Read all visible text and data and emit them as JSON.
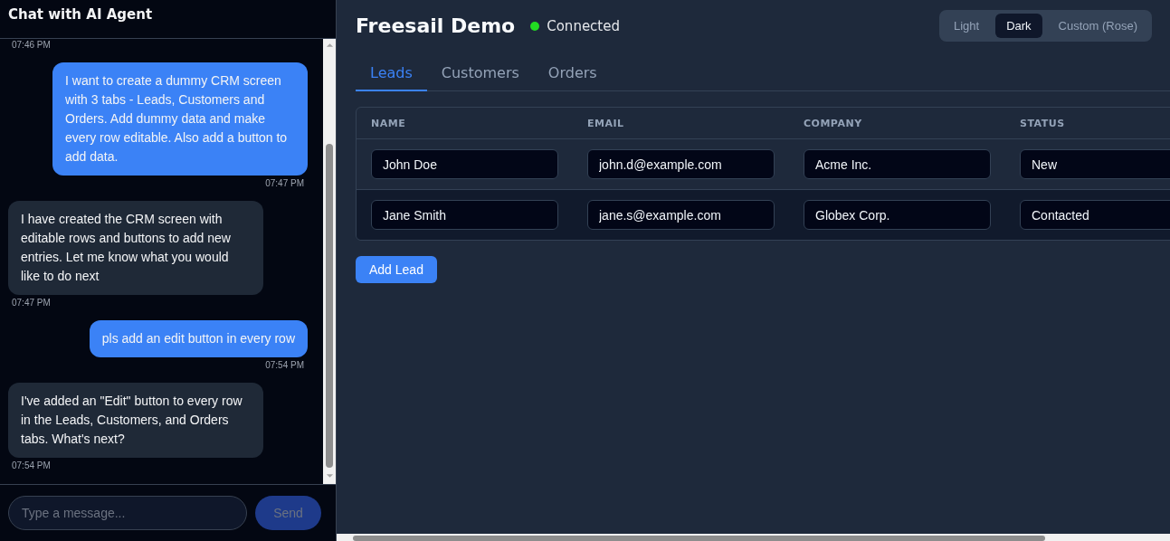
{
  "chat": {
    "title": "Chat with AI Agent",
    "earlier_time": "07:46 PM",
    "messages": [
      {
        "kind": "user",
        "text": "I want to create a dummy CRM screen with 3 tabs - Leads, Customers and Orders. Add dummy data and make every row editable. Also add a button to add data.",
        "time": "07:47 PM"
      },
      {
        "kind": "agent",
        "text": "I have created the CRM screen with editable rows and buttons to add new entries. Let me know what you would like to do next",
        "time": "07:47 PM"
      },
      {
        "kind": "user",
        "text": "pls add an edit button in every row",
        "time": "07:54 PM"
      },
      {
        "kind": "agent",
        "text": "I've added an \"Edit\" button to every row in the Leads, Customers, and Orders tabs. What's next?",
        "time": "07:54 PM"
      }
    ],
    "input": {
      "placeholder": "Type a message..."
    },
    "send_button": {
      "label": "Send",
      "disabled": true
    }
  },
  "main": {
    "title": "Freesail Demo",
    "status": {
      "label": "Connected",
      "connected": true
    },
    "themes": [
      {
        "label": "Light",
        "selected": false
      },
      {
        "label": "Dark",
        "selected": true
      },
      {
        "label": "Custom (Rose)",
        "selected": false
      }
    ],
    "tabs": [
      {
        "label": "Leads",
        "selected": true
      },
      {
        "label": "Customers",
        "selected": false
      },
      {
        "label": "Orders",
        "selected": false
      }
    ],
    "table": {
      "columns": [
        "NAME",
        "EMAIL",
        "COMPANY",
        "STATUS"
      ],
      "rows": [
        {
          "cells": [
            "John Doe",
            "john.d@example.com",
            "Acme Inc.",
            "New"
          ],
          "hovered": false
        },
        {
          "cells": [
            "Jane Smith",
            "jane.s@example.com",
            "Globex Corp.",
            "Contacted"
          ],
          "hovered": true
        }
      ]
    },
    "add_button": "Add Lead"
  }
}
